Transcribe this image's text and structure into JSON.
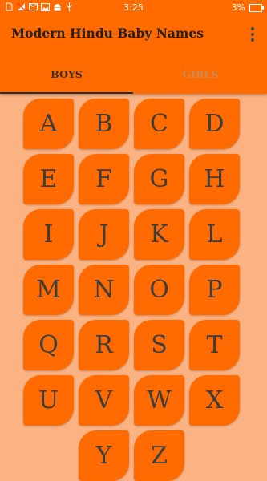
{
  "status_bar": {
    "time": "3:25",
    "battery": "3%",
    "battery_level": 0.03,
    "icons": [
      "sim-icon",
      "signal-icon",
      "email-icon",
      "image-icon",
      "android-icon",
      "usb-icon"
    ]
  },
  "app_bar": {
    "title": "Modern Hindu Baby Names",
    "menu_icon": "more-vert-icon"
  },
  "tabs": [
    {
      "label": "BOYS",
      "selected": true
    },
    {
      "label": "GIRLS",
      "selected": false
    }
  ],
  "letters": [
    "A",
    "B",
    "C",
    "D",
    "E",
    "F",
    "G",
    "H",
    "I",
    "J",
    "K",
    "L",
    "M",
    "N",
    "O",
    "P",
    "Q",
    "R",
    "S",
    "T",
    "U",
    "V",
    "W",
    "X",
    "Y",
    "Z"
  ],
  "colors": {
    "primary": "#ff6b00",
    "background": "#fcb383",
    "letter_text": "#3d3d3d",
    "tab_selected": "#3a2f27",
    "tab_unselected": "#c88a56"
  }
}
